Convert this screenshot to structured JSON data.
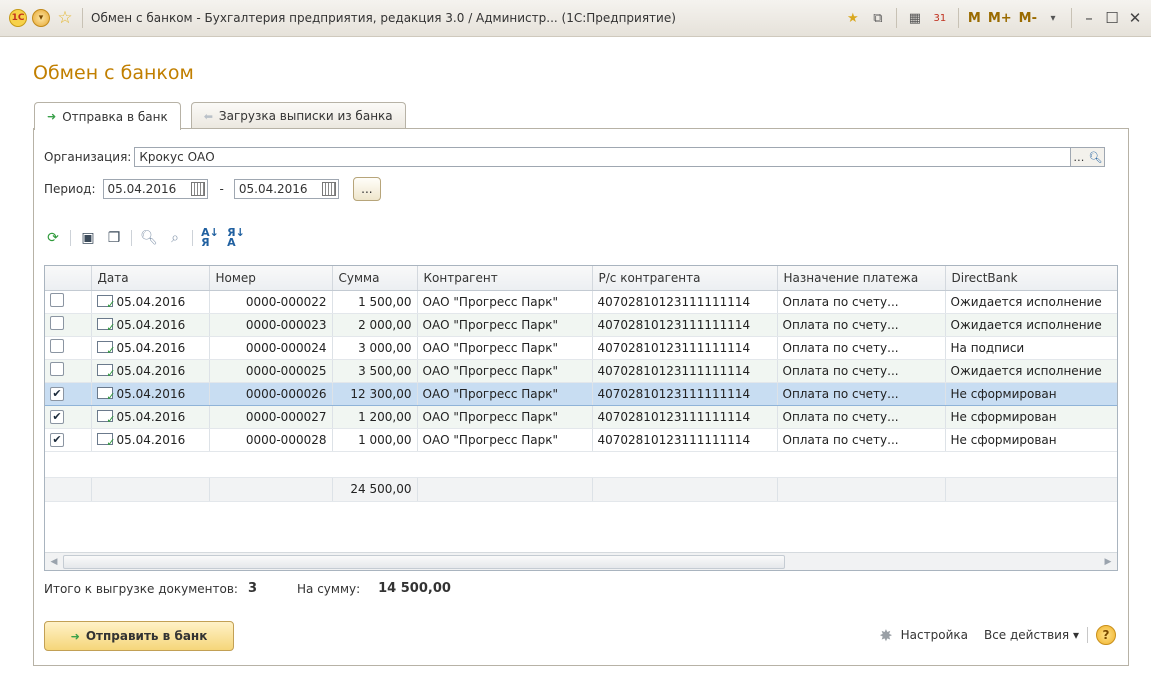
{
  "window": {
    "title": "Обмен с банком - Бухгалтерия предприятия, редакция 3.0 / Администр...  (1С:Предприятие)",
    "m_labels": [
      "M",
      "M+",
      "M-"
    ]
  },
  "form": {
    "title": "Обмен с банком",
    "tabs": [
      {
        "label": "Отправка в банк",
        "active": true
      },
      {
        "label": "Загрузка выписки из банка",
        "active": false
      }
    ],
    "organization_label": "Организация:",
    "organization_value": "Крокус ОАО",
    "period_label": "Период:",
    "period_from": "05.04.2016",
    "period_dash": "-",
    "period_to": "05.04.2016",
    "dots_button": "..."
  },
  "table": {
    "columns": [
      "",
      "Дата",
      "Номер",
      "Сумма",
      "Контрагент",
      "Р/с контрагента",
      "Назначение платежа",
      "DirectBank"
    ],
    "rows": [
      {
        "checked": false,
        "date": "05.04.2016",
        "number": "0000-000022",
        "sum": "1 500,00",
        "counterparty": "ОАО \"Прогресс Парк\"",
        "account": "40702810123111111114",
        "purpose": "Оплата по счету...",
        "status": "Ожидается исполнение"
      },
      {
        "checked": false,
        "date": "05.04.2016",
        "number": "0000-000023",
        "sum": "2 000,00",
        "counterparty": "ОАО \"Прогресс Парк\"",
        "account": "40702810123111111114",
        "purpose": "Оплата по счету...",
        "status": "Ожидается исполнение"
      },
      {
        "checked": false,
        "date": "05.04.2016",
        "number": "0000-000024",
        "sum": "3 000,00",
        "counterparty": "ОАО \"Прогресс Парк\"",
        "account": "40702810123111111114",
        "purpose": "Оплата по счету...",
        "status": "На подписи"
      },
      {
        "checked": false,
        "date": "05.04.2016",
        "number": "0000-000025",
        "sum": "3 500,00",
        "counterparty": "ОАО \"Прогресс Парк\"",
        "account": "40702810123111111114",
        "purpose": "Оплата по счету...",
        "status": "Ожидается исполнение"
      },
      {
        "checked": true,
        "date": "05.04.2016",
        "number": "0000-000026",
        "sum": "12 300,00",
        "counterparty": "ОАО \"Прогресс Парк\"",
        "account": "40702810123111111114",
        "purpose": "Оплата по счету...",
        "status": "Не сформирован"
      },
      {
        "checked": true,
        "date": "05.04.2016",
        "number": "0000-000027",
        "sum": "1 200,00",
        "counterparty": "ОАО \"Прогресс Парк\"",
        "account": "40702810123111111114",
        "purpose": "Оплата по счету...",
        "status": "Не сформирован"
      },
      {
        "checked": true,
        "date": "05.04.2016",
        "number": "0000-000028",
        "sum": "1 000,00",
        "counterparty": "ОАО \"Прогресс Парк\"",
        "account": "40702810123111111114",
        "purpose": "Оплата по счету...",
        "status": "Не сформирован"
      }
    ],
    "total_sum": "24 500,00"
  },
  "summary": {
    "count_label": "Итого к выгрузке документов:",
    "count_value": "3",
    "sum_label": "На сумму:",
    "sum_value": "14 500,00"
  },
  "footer": {
    "send_button": "Отправить в банк",
    "settings": "Настройка",
    "all_actions": "Все действия ▾",
    "help": "?"
  }
}
